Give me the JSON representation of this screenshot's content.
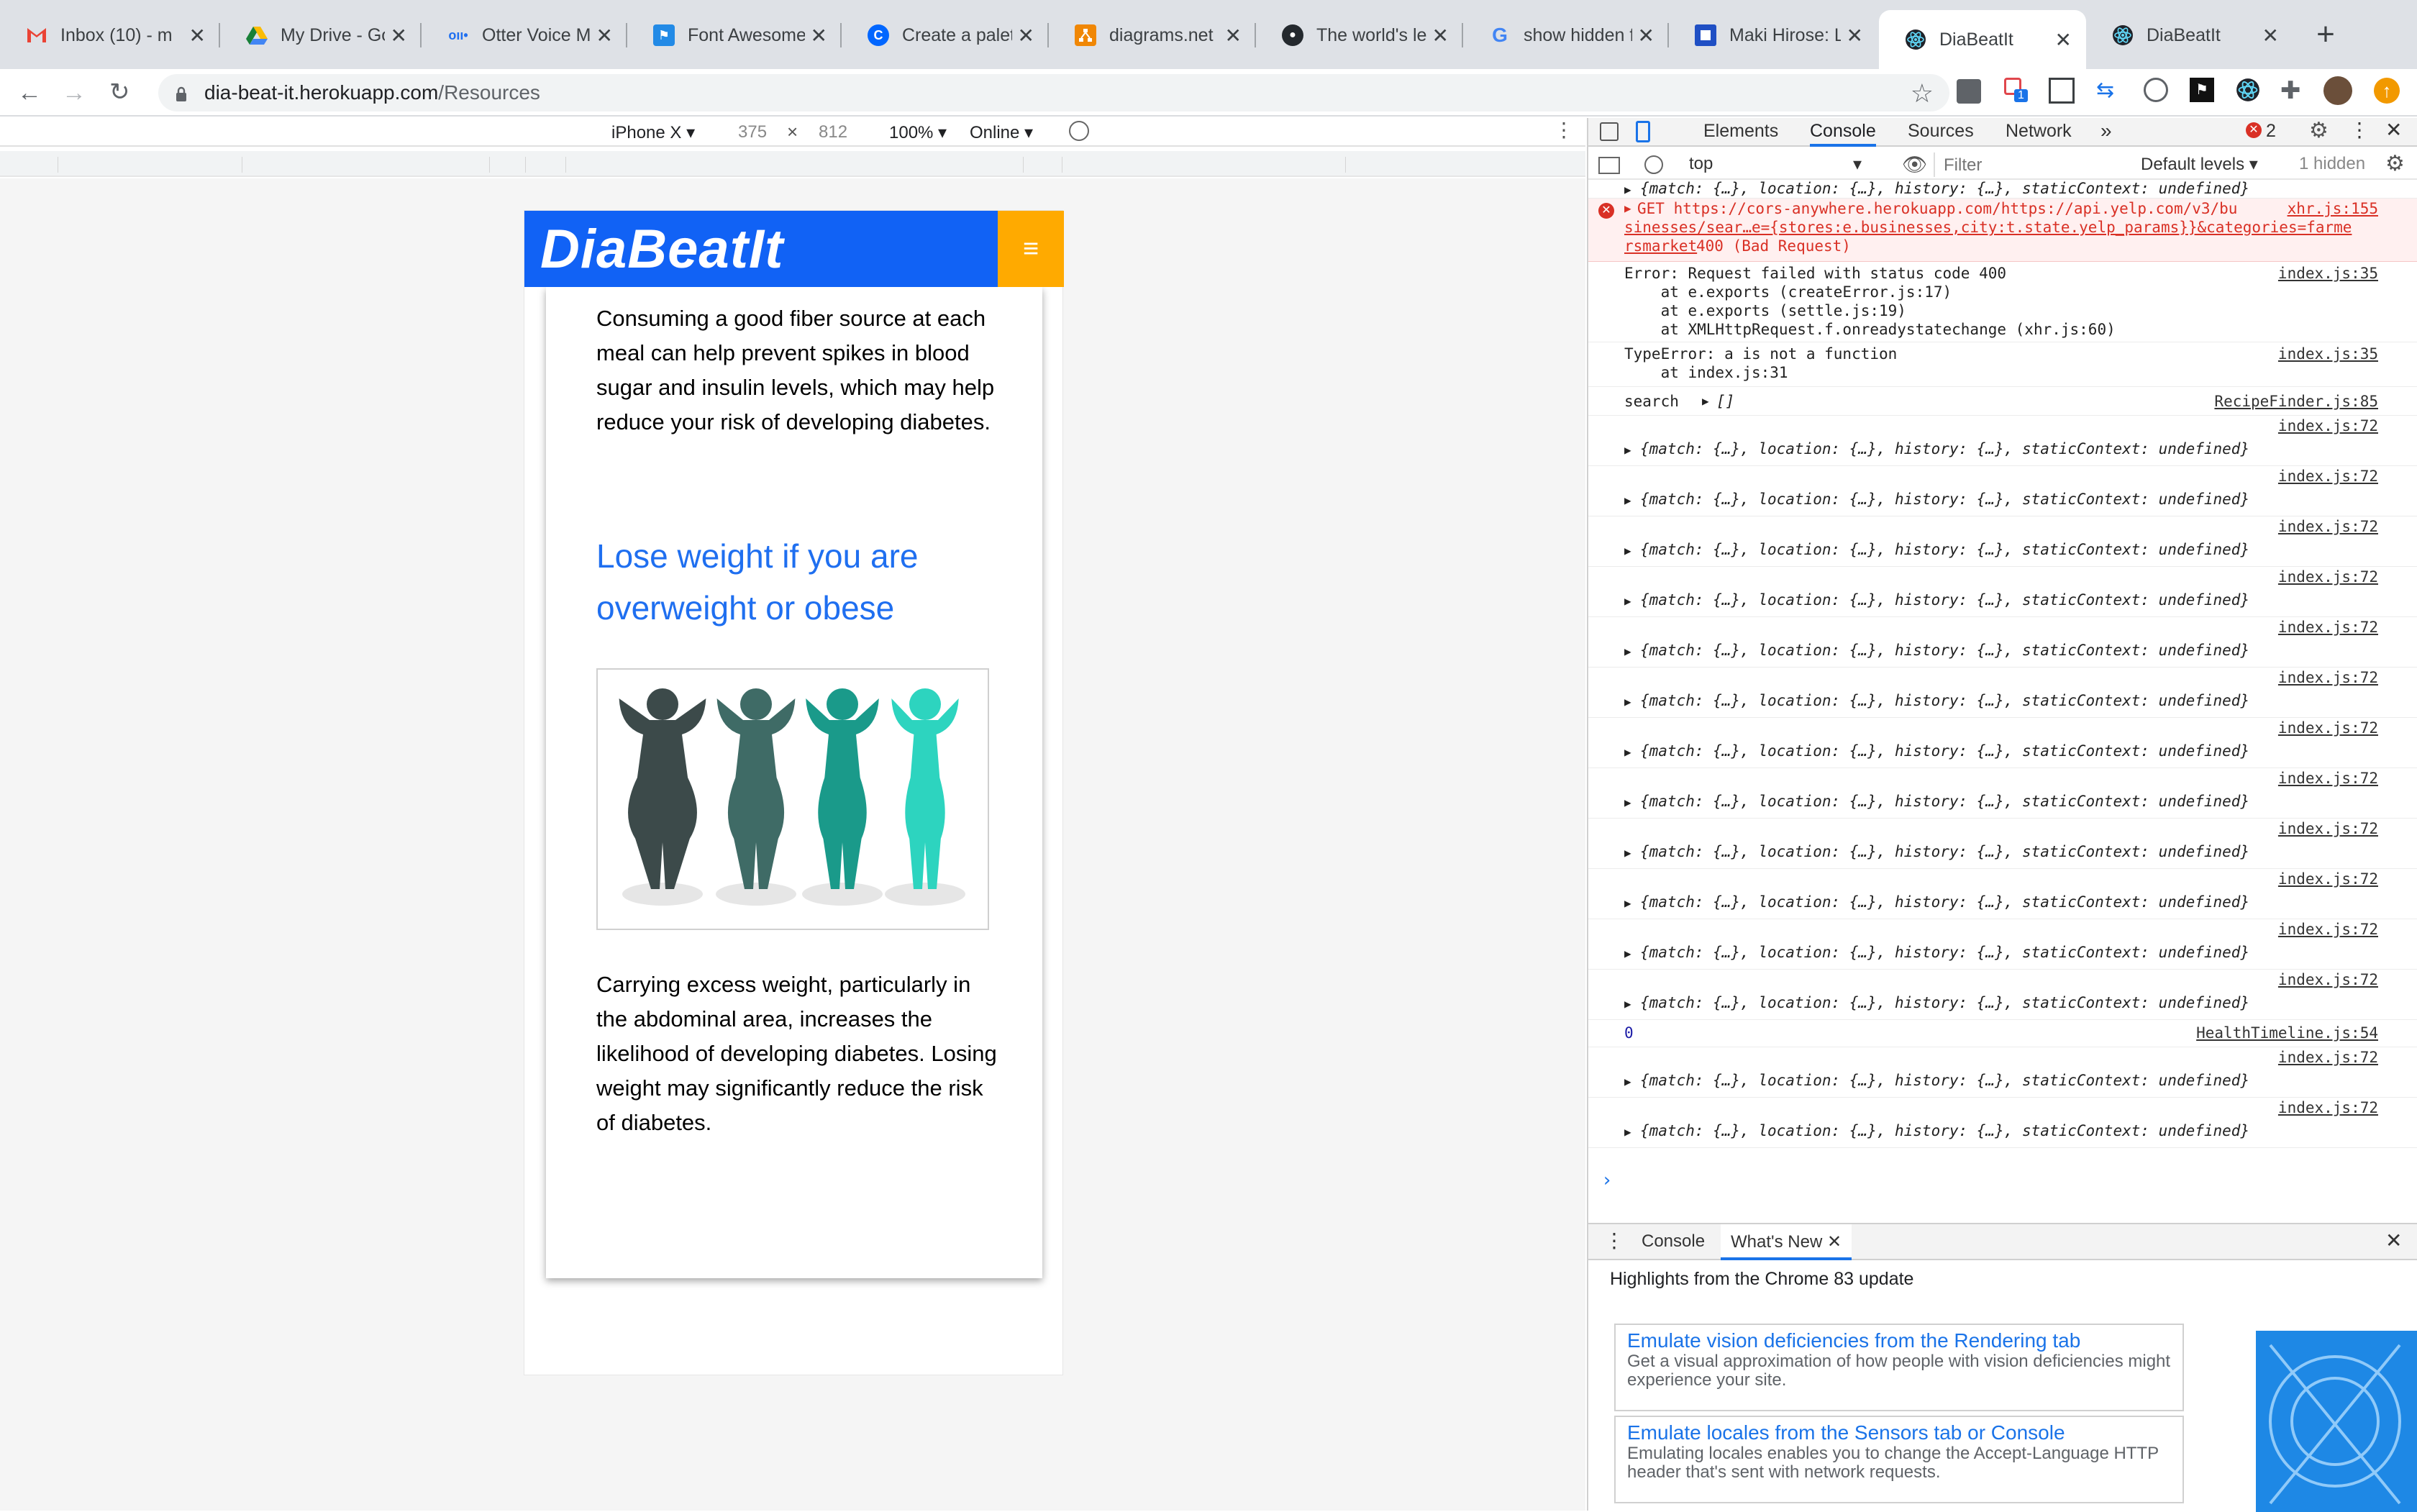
{
  "tabs": [
    {
      "title": "Inbox (10) - m",
      "icon": "gmail-icon"
    },
    {
      "title": "My Drive - Go",
      "icon": "google-drive-icon"
    },
    {
      "title": "Otter Voice M",
      "icon": "otter-icon"
    },
    {
      "title": "Font Awesome",
      "icon": "font-awesome-flag-icon"
    },
    {
      "title": "Create a palet",
      "icon": "coolors-icon"
    },
    {
      "title": "diagrams.net",
      "icon": "diagrams-net-icon"
    },
    {
      "title": "The world's le",
      "icon": "github-icon"
    },
    {
      "title": "show hidden f",
      "icon": "google-icon"
    },
    {
      "title": "Maki Hirose: L",
      "icon": "page-icon"
    },
    {
      "title": "DiaBeatIt",
      "icon": "react-icon",
      "active": true
    },
    {
      "title": "DiaBeatIt",
      "icon": "react-icon"
    }
  ],
  "address": {
    "host": "dia-beat-it.herokuapp.com",
    "path": "/Resources"
  },
  "device_toolbar": {
    "device": "iPhone X",
    "width": "375",
    "height": "812",
    "zoom": "100%",
    "network": "Online"
  },
  "site": {
    "brand": "DiaBeatIt",
    "para1": "Consuming a good fiber source at each meal can help prevent spikes in blood sugar and insulin levels, which may help reduce your risk of developing diabetes.",
    "section_title": "Lose weight if you are overweight or obese",
    "para2": "Carrying excess weight, particularly in the abdominal area, increases the likelihood of developing diabetes. Losing weight may significantly reduce the risk of diabetes.",
    "figure_colors": [
      "#3c4a4a",
      "#3f6b66",
      "#1a9a8a",
      "#2dd4bf"
    ]
  },
  "devtools": {
    "tabs": [
      "Elements",
      "Console",
      "Sources",
      "Network"
    ],
    "active_tab": "Console",
    "error_count": "2",
    "context": "top",
    "filter_placeholder": "Filter",
    "levels": "Default levels",
    "hidden": "1 hidden",
    "rows": {
      "r0": {
        "msg": "{match: {…}, location: {…}, history: {…}, staticContext: undefined}"
      },
      "err": {
        "line1": "GET https://cors-anywhere.herokuapp.com/https://api.yelp.com/v3/bu",
        "line2": "sinesses/sear…e={stores:e.businesses,city:t.state.yelp_params}}&categories=farme",
        "line3": "rsmarket",
        "status": "400 (Bad Request)",
        "src": "xhr.js:155"
      },
      "e1": {
        "line1": "Error: Request failed with status code 400",
        "line2": "    at e.exports (createError.js:17)",
        "line3": "    at e.exports (settle.js:19)",
        "line4": "    at XMLHttpRequest.f.onreadystatechange (xhr.js:60)",
        "src": "index.js:35"
      },
      "e2": {
        "line1": "TypeError: a is not a function",
        "line2": "    at index.js:31",
        "src": "index.js:35"
      },
      "search": {
        "label": "search",
        "value": "[]",
        "src": "RecipeFinder.js:85"
      },
      "obj": "{match: {…}, location: {…}, history: {…}, staticContext: undefined}",
      "objsrc": "index.js:72",
      "zero": {
        "value": "0",
        "src": "HealthTimeline.js:54"
      }
    },
    "drawer": {
      "tabs": [
        "Console",
        "What's New"
      ],
      "headline": "Highlights from the Chrome 83 update",
      "cards": [
        {
          "title": "Emulate vision deficiencies from the Rendering tab",
          "desc": "Get a visual approximation of how people with vision deficiencies might experience your site."
        },
        {
          "title": "Emulate locales from the Sensors tab or Console",
          "desc": "Emulating locales enables you to change the Accept-Language HTTP header that's sent with network requests."
        }
      ]
    }
  }
}
